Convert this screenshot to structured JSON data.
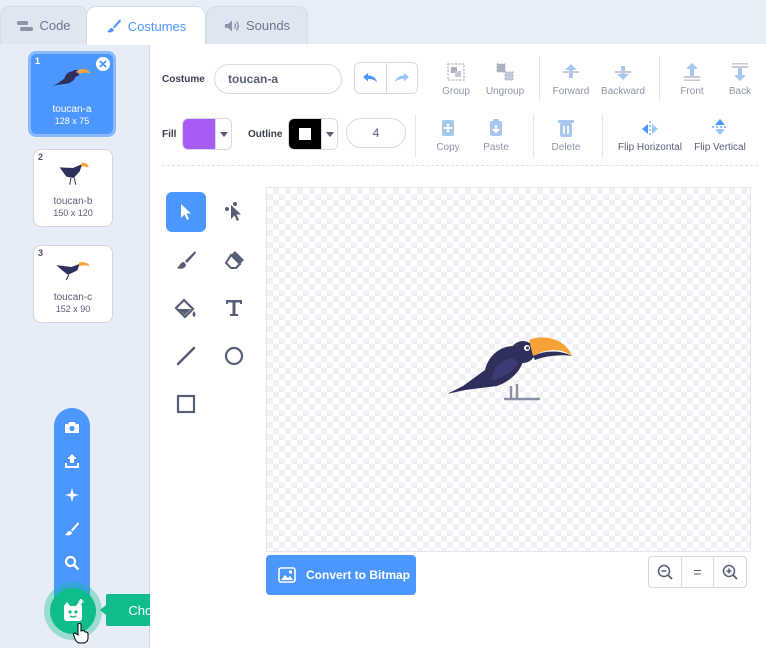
{
  "tabs": [
    {
      "label": "Code",
      "icon": "code-icon"
    },
    {
      "label": "Costumes",
      "icon": "brush-icon"
    },
    {
      "label": "Sounds",
      "icon": "speaker-icon"
    }
  ],
  "costumes": [
    {
      "number": "1",
      "name": "toucan-a",
      "size": "128 x 75",
      "selected": true
    },
    {
      "number": "2",
      "name": "toucan-b",
      "size": "150 x 120",
      "selected": false
    },
    {
      "number": "3",
      "name": "toucan-c",
      "size": "152 x 90",
      "selected": false
    }
  ],
  "editor": {
    "costume_label": "Costume",
    "costume_name": "toucan-a",
    "fill_label": "Fill",
    "outline_label": "Outline",
    "outline_width": "4",
    "fill_color": "#a75cf6",
    "outline_color": "#000000",
    "accent_color": "#4c97ff"
  },
  "toolbar": {
    "group": "Group",
    "ungroup": "Ungroup",
    "forward": "Forward",
    "backward": "Backward",
    "front": "Front",
    "back": "Back",
    "copy": "Copy",
    "paste": "Paste",
    "delete": "Delete",
    "flip_horizontal": "Flip Horizontal",
    "flip_vertical": "Flip Vertical"
  },
  "tools": [
    "select-icon",
    "reshape-icon",
    "brush-icon",
    "eraser-icon",
    "fill-icon",
    "text-icon",
    "line-icon",
    "circle-icon",
    "rectangle-icon"
  ],
  "convert_button": "Convert to Bitmap",
  "zoom": {
    "out": "−",
    "reset": "=",
    "in": "+"
  },
  "choose_costume_tooltip": "Choose a Costume"
}
